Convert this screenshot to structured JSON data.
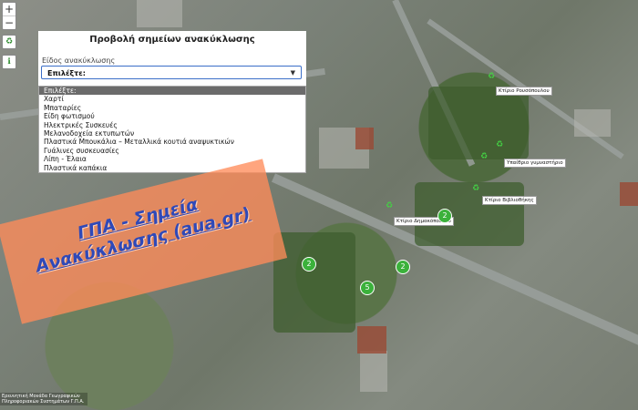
{
  "panel": {
    "title": "Προβολή σημείων ανακύκλωσης",
    "field_label": "Είδος ανακύκλωσης",
    "select_value": "Επιλέξτε:"
  },
  "dropdown": {
    "options": [
      "Επιλέξτε:",
      "Χαρτί",
      "Μπαταρίες",
      "Είδη φωτισμού",
      "Ηλεκτρικές Συσκευές",
      "Μελανοδοχεία εκτυπωτών",
      "Πλαστικά Μπουκάλια – Μεταλλικά κουτιά αναψυκτικών",
      "Γυάλινες συσκευασίες",
      "Λίπη - Έλαια",
      "Πλαστικά καπάκια"
    ],
    "selected_index": 0
  },
  "map_labels": {
    "rousopoulou": "Κτίριο Ρουσόπουλου",
    "ypaithrio": "Υπαίθριο γυμναστήριο",
    "vivliothikis": "Κτίριο Βιβλιοθήκης",
    "dimakopoulou": "Κτίριο Δημακόπουλου"
  },
  "markers": {
    "m1": "2",
    "m2": "2",
    "m3": "2",
    "m4": "5"
  },
  "banner": {
    "line1": "ΓΠΑ - Σημεία",
    "line2": "Ανακύκλωσης (aua.gr)"
  },
  "footer": {
    "line1": "Ερευνητική Μονάδα Γεωγραφικών",
    "line2": "Πληροφοριακών Συστημάτων Γ.Π.Α."
  },
  "controls": {
    "zoom_in": "+",
    "zoom_out": "−"
  },
  "colors": {
    "marker": "#3bb13b",
    "banner": "#ff8c5a",
    "banner_text": "#2f49b8",
    "select_border": "#3b6fc8"
  }
}
